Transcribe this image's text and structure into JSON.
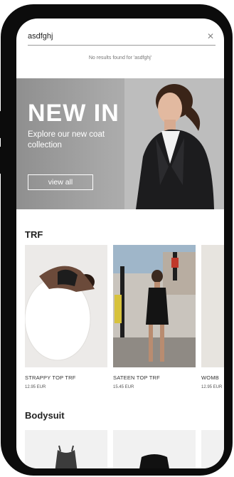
{
  "search": {
    "value": "asdfghj",
    "no_results": "No results found for 'asdfghj'"
  },
  "hero": {
    "title": "NEW IN",
    "subtitle": "Explore our new coat collection",
    "button_label": "view all"
  },
  "sections": [
    {
      "title": "TRF",
      "products": [
        {
          "name": "STRAPPY TOP TRF",
          "price": "12.95 EUR"
        },
        {
          "name": "SATEEN TOP TRF",
          "price": "15.45 EUR"
        },
        {
          "name": "WOMB",
          "price": "12.95 EUR"
        }
      ]
    },
    {
      "title": "Bodysuit"
    }
  ],
  "colors": {
    "frame": "#0c0c0c",
    "hero_bg": "#a9a9a9",
    "text": "#222222"
  }
}
